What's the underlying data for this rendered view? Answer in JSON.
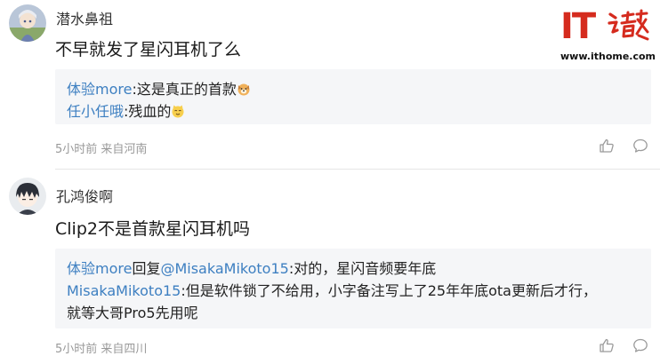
{
  "watermark": {
    "logo_text": "IT",
    "url": "www.ithome.com"
  },
  "comments": [
    {
      "user": "潜水鼻祖",
      "content": "不早就发了星闪耳机了么",
      "replies": [
        {
          "author": "体验more",
          "sep": ":",
          "text": "这是真正的首款",
          "emoji": "dog-emoji"
        },
        {
          "author": "任小任哦",
          "sep": ":",
          "text": "残血的",
          "emoji": "cat-emoji"
        }
      ],
      "meta": "5小时前 来自河南"
    },
    {
      "user": "孔鸿俊啊",
      "content": "Clip2不是首款星闪耳机吗",
      "replies": [
        {
          "author": "体验more",
          "reply_word": "回复",
          "target": "@MisakaMikoto15",
          "sep": ":",
          "text": "对的，星闪音频要年底"
        },
        {
          "author": "MisakaMikoto15",
          "sep": ":",
          "text": "但是软件锁了不给用，小字备注写上了25年年底ota更新后才行，",
          "text_cont": "就等大哥Pro5先用呢"
        }
      ],
      "meta": "5小时前 来自四川"
    }
  ],
  "colors": {
    "link": "#3d7fc1",
    "quote_bg": "#f5f6f8",
    "logo_red": "#d52b1e",
    "meta_gray": "#999999"
  }
}
